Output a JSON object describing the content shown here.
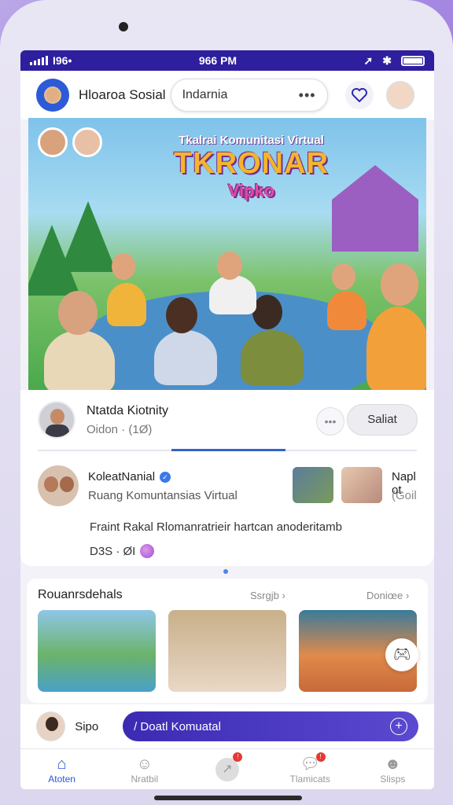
{
  "status": {
    "carrier": "I96•",
    "time": "966 PM"
  },
  "header": {
    "app_name": "Hloaroa Sosial",
    "search_value": "Indarnia",
    "search_dots": "•••"
  },
  "hero": {
    "kicker": "Tkalrai Komunitasi Virtual",
    "headline": "TKRONAR",
    "subline": "Vipko"
  },
  "post": {
    "author": "Ntatda Kiotnity",
    "meta": "Oidon · (1Ø)",
    "more": "•••",
    "button": "Saliat",
    "progress": 0.3
  },
  "community": {
    "name": "KoleatNanial",
    "subtitle": "Ruang Komuntansias Virtual",
    "side_name": "Napl ot",
    "side_sub": "(Goil",
    "description": "Fraint Rakal Rlomanratrieir hartcan anoderitamb",
    "date": "D3S · ØI"
  },
  "recommendations": {
    "title": "Rouanrsdehals",
    "link1": "Ssrgjb ›",
    "link2": "Doniœe ›"
  },
  "comment": {
    "name": "Sipo",
    "placeholder": "/ Doatl Komuatal"
  },
  "tabs": [
    {
      "label": "Atoten"
    },
    {
      "label": "Nratbil"
    },
    {
      "label": ""
    },
    {
      "label": "Tlamicats"
    },
    {
      "label": "Slisps"
    }
  ],
  "colors": {
    "accent": "#2a57d9",
    "status_bar": "#2d1f9e",
    "comment_bar": "#4a3bc6"
  }
}
